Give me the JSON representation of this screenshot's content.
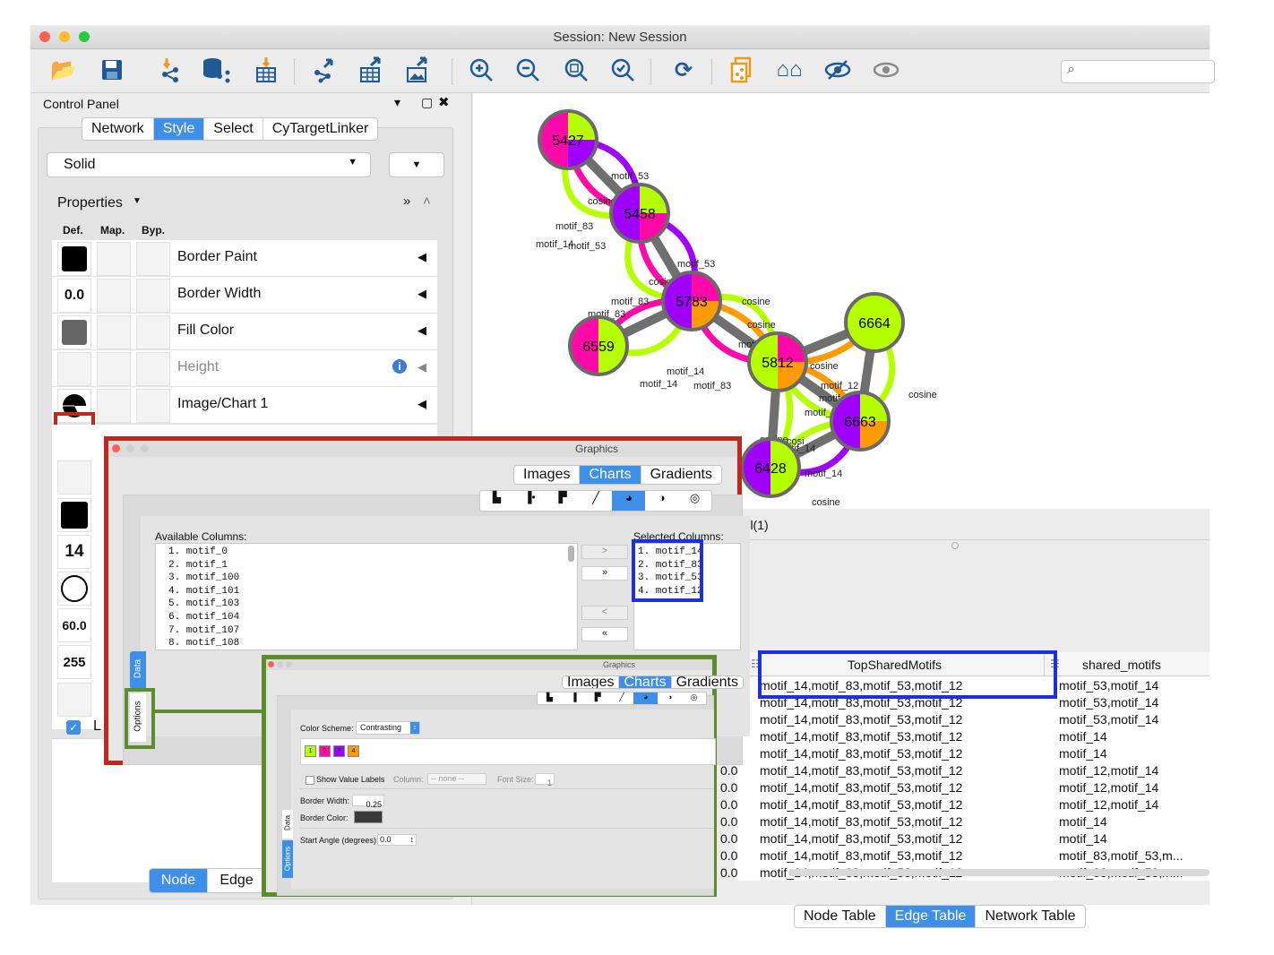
{
  "window": {
    "title": "Session: New Session",
    "search_placeholder": ""
  },
  "toolbar": {
    "icons": [
      "open-folder-icon",
      "save-icon",
      "import-network-icon",
      "import-database-icon",
      "import-table-icon",
      "export-network-icon",
      "export-table-icon",
      "export-image-icon",
      "zoom-in-icon",
      "zoom-out-icon",
      "zoom-fit-icon",
      "zoom-selected-icon",
      "refresh-icon",
      "new-network-icon",
      "home-icon",
      "hide-icon",
      "show-icon"
    ]
  },
  "control_panel": {
    "title": "Control Panel",
    "tabs": [
      "Network",
      "Style",
      "Select",
      "CyTargetLinker"
    ],
    "active_tab": "Style",
    "style_select": "Solid",
    "properties_label": "Properties",
    "col_headers": [
      "Def.",
      "Map.",
      "Byp."
    ],
    "rows": [
      {
        "def": "",
        "label": "Border Paint"
      },
      {
        "def": "0.0",
        "label": "Border Width"
      },
      {
        "def": "",
        "label": "Fill Color"
      },
      {
        "def": "",
        "label": "Height"
      },
      {
        "def": "",
        "label": "Image/Chart 1"
      }
    ],
    "side_values": [
      "14",
      "60.0",
      "255"
    ],
    "checkbox_label": "L",
    "bottom_tabs": [
      "Node",
      "Edge"
    ],
    "active_bottom_tab": "Node"
  },
  "network": {
    "nodes": [
      "5427",
      "5458",
      "5783",
      "6559",
      "5812",
      "6664",
      "6663",
      "6428"
    ],
    "edge_labels": [
      "motif_53",
      "cosine",
      "motif_83",
      "motif_14",
      "motif_53",
      "cosine",
      "motif_83",
      "motif_83",
      "motif_14",
      "motif_12",
      "cosine",
      "cosine",
      "motif_14",
      "motif_83",
      "cosine",
      "motif_12",
      "motif_",
      "cosine",
      "motif_14",
      "cosine",
      "cosi",
      "motif_14",
      "motif_14",
      "cosine",
      "motif_53"
    ],
    "colors": {
      "motif_14": "#b5ff00",
      "motif_83": "#ff0aa8",
      "motif_53": "#a000ff",
      "motif_12": "#ff9a00",
      "cosine": "#6f6f6f"
    }
  },
  "table_panel": {
    "tab_label": "hml(1)",
    "columns": [
      "TopSharedMotifs",
      "shared_motifs"
    ],
    "rows": [
      {
        "num": "0.0",
        "top": "motif_14,motif_83,motif_53,motif_12",
        "shared": "motif_53,motif_14"
      },
      {
        "num": "0.0",
        "top": "motif_14,motif_83,motif_53,motif_12",
        "shared": "motif_53,motif_14"
      },
      {
        "num": "0.0",
        "top": "motif_14,motif_83,motif_53,motif_12",
        "shared": "motif_53,motif_14"
      },
      {
        "num": "0.0",
        "top": "motif_14,motif_83,motif_53,motif_12",
        "shared": "motif_14"
      },
      {
        "num": "0.0",
        "top": "motif_14,motif_83,motif_53,motif_12",
        "shared": "motif_14"
      },
      {
        "num": "0.0",
        "top": "motif_14,motif_83,motif_53,motif_12",
        "shared": "motif_12,motif_14"
      },
      {
        "num": "0.0",
        "top": "motif_14,motif_83,motif_53,motif_12",
        "shared": "motif_12,motif_14"
      },
      {
        "num": "0.0",
        "top": "motif_14,motif_83,motif_53,motif_12",
        "shared": "motif_12,motif_14"
      },
      {
        "num": "0.0",
        "top": "motif_14,motif_83,motif_53,motif_12",
        "shared": "motif_14"
      },
      {
        "num": "0.0",
        "top": "motif_14,motif_83,motif_53,motif_12",
        "shared": "motif_14"
      },
      {
        "num": "0.0",
        "top": "motif_14,motif_83,motif_53,motif_12",
        "shared": "motif_83,motif_53,m..."
      },
      {
        "num": "0.0",
        "top": "motif_14,motif_83,motif_53,motif_12",
        "shared": "motif_83,motif_53,m..."
      }
    ],
    "bottom_tabs": [
      "Node Table",
      "Edge Table",
      "Network Table"
    ],
    "active_bottom_tab": "Edge Table"
  },
  "graphics_dialog": {
    "title": "Graphics",
    "tabs": [
      "Images",
      "Charts",
      "Gradients"
    ],
    "active_tab": "Charts",
    "side_tabs": [
      "Data",
      "Options"
    ],
    "available_label": "Available Columns:",
    "available_columns": [
      "1. motif_0",
      "2. motif_1",
      "3. motif_100",
      "4. motif_101",
      "5. motif_103",
      "6. motif_104",
      "7. motif_107",
      "8. motif_108"
    ],
    "selected_label": "Selected Columns:",
    "selected_columns": [
      "1. motif_14",
      "2. motif_83",
      "3. motif_53",
      "4. motif_12"
    ],
    "buttons": [
      ">",
      "»",
      "<",
      "«"
    ]
  },
  "options_dialog": {
    "title": "Graphics",
    "tabs": [
      "Images",
      "Charts",
      "Gradients"
    ],
    "active_tab": "Charts",
    "color_scheme_label": "Color Scheme:",
    "color_scheme_value": "Contrasting",
    "swatches": [
      {
        "n": "1",
        "c": "#b5ff00"
      },
      {
        "n": "2",
        "c": "#ff0aa8"
      },
      {
        "n": "3",
        "c": "#a000ff"
      },
      {
        "n": "4",
        "c": "#ff9a00"
      }
    ],
    "show_value_labels": "Show Value Labels",
    "column_label": "Column:",
    "column_value": "-- none --",
    "font_size_label": "Font Size:",
    "font_size_value": "1",
    "border_width_label": "Border Width:",
    "border_width_value": "0.25",
    "border_color_label": "Border Color:",
    "start_angle_label": "Start Angle (degrees):",
    "start_angle_value": "0.0",
    "side_tabs": [
      "Data",
      "Options"
    ]
  }
}
